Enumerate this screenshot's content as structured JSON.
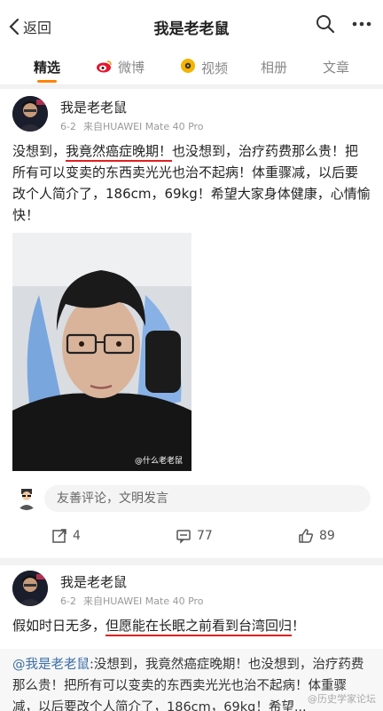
{
  "topbar": {
    "back_label": "返回",
    "title": "我是老老鼠"
  },
  "tabs": [
    {
      "label": "精选"
    },
    {
      "label": "微博"
    },
    {
      "label": "视频"
    },
    {
      "label": "相册"
    },
    {
      "label": "文章"
    }
  ],
  "post1": {
    "author": "我是老老鼠",
    "date": "6-2",
    "source": "来自HUAWEI Mate 40 Pro",
    "text_before": "没想到，",
    "text_underlined": "我竟然癌症晚期！",
    "text_after": "也没想到，治疗药费那么贵！把所有可以变卖的东西卖光光也治不起病！体重骤减，以后要改个人简介了，186cm，69kg！希望大家身体健康，心情愉快！",
    "photo_watermark": "@什么老老鼠",
    "comment_placeholder": "友善评论，文明发言",
    "reposts": "4",
    "comments": "77",
    "likes": "89"
  },
  "post2": {
    "author": "我是老老鼠",
    "date": "6-2",
    "source": "来自HUAWEI Mate 40 Pro",
    "text_before": "假如时日无多，",
    "text_underlined": "但愿能在长眠之前看到台湾回归",
    "text_after": "！",
    "quote_mention": "@我是老老鼠",
    "quote_text": ":没想到，我竟然癌症晚期！也没想到，治疗药费那么贵！把所有可以变卖的东西卖光光也治不起病！体重骤减，以后要改个人简介了，186cm，69kg！希望...",
    "watermark": "@历史学家论坛"
  },
  "colors": {
    "accent": "#ff8200",
    "underline": "#e02020",
    "link": "#3a6da6"
  }
}
